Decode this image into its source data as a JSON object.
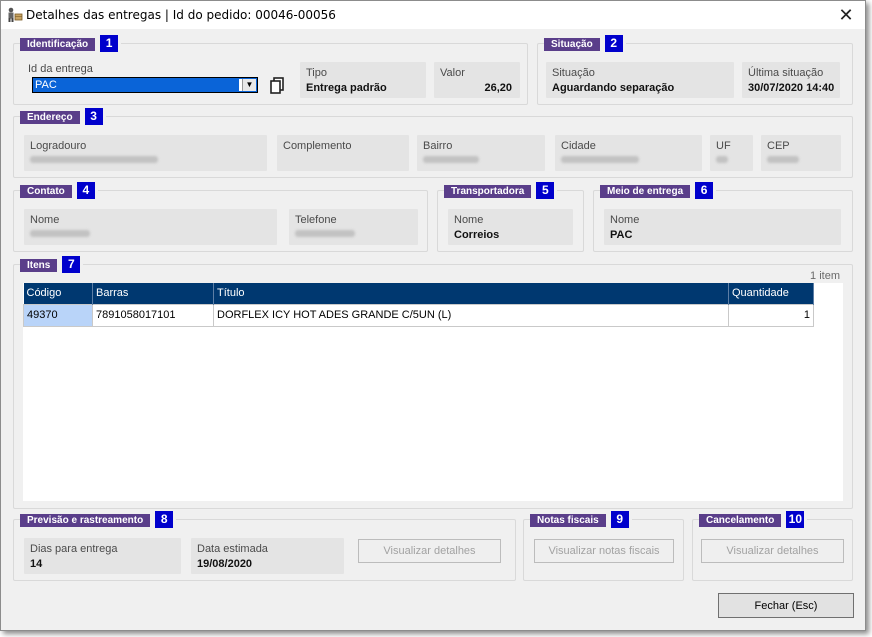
{
  "window": {
    "title": "Detalhes das entregas | Id do pedido: 00046-00056"
  },
  "identificacao": {
    "label": "Identificação",
    "num": "1",
    "id_entrega_label": "Id da entrega",
    "id_entrega_value": "PAC",
    "tipo_label": "Tipo",
    "tipo_value": "Entrega padrão",
    "valor_label": "Valor",
    "valor_value": "26,20"
  },
  "situacao": {
    "label": "Situação",
    "num": "2",
    "situacao_label": "Situação",
    "situacao_value": "Aguardando separação",
    "ultima_label": "Última situação",
    "ultima_value": "30/07/2020 14:40"
  },
  "endereco": {
    "label": "Endereço",
    "num": "3",
    "logradouro_label": "Logradouro",
    "complemento_label": "Complemento",
    "bairro_label": "Bairro",
    "cidade_label": "Cidade",
    "uf_label": "UF",
    "cep_label": "CEP"
  },
  "contato": {
    "label": "Contato",
    "num": "4",
    "nome_label": "Nome",
    "telefone_label": "Telefone"
  },
  "transportadora": {
    "label": "Transportadora",
    "num": "5",
    "nome_label": "Nome",
    "nome_value": "Correios"
  },
  "meio": {
    "label": "Meio de entrega",
    "num": "6",
    "nome_label": "Nome",
    "nome_value": "PAC"
  },
  "itens": {
    "label": "Itens",
    "num": "7",
    "count": "1 item",
    "columns": [
      "Código",
      "Barras",
      "Título",
      "Quantidade"
    ],
    "rows": [
      [
        "49370",
        "7891058017101",
        "DORFLEX ICY HOT ADES GRANDE C/5UN (L)",
        "1"
      ]
    ]
  },
  "previsao": {
    "label": "Previsão e rastreamento",
    "num": "8",
    "dias_label": "Dias para entrega",
    "dias_value": "14",
    "data_label": "Data estimada",
    "data_value": "19/08/2020",
    "button": "Visualizar detalhes"
  },
  "notas": {
    "label": "Notas fiscais",
    "num": "9",
    "button": "Visualizar notas fiscais"
  },
  "cancelamento": {
    "label": "Cancelamento",
    "num": "10",
    "button": "Visualizar detalhes"
  },
  "footer": {
    "close_button": "Fechar (Esc)"
  },
  "icons": {
    "app": "delivery-person-icon",
    "close": "close-icon",
    "copy": "copy-icon",
    "dropdown": "chevron-down-icon"
  },
  "colors": {
    "group_label_bg": "#5a3e8a",
    "group_num_bg": "#0000cc",
    "grid_header_bg": "#003870",
    "selection": "#0a64d8"
  }
}
